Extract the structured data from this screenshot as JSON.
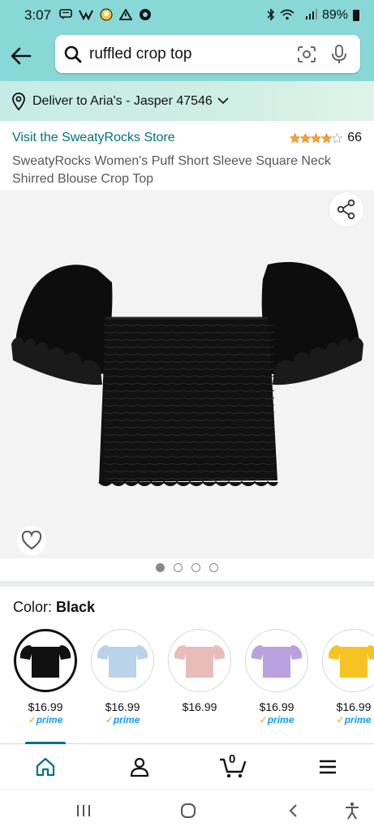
{
  "status_bar": {
    "time": "3:07",
    "battery": "89%"
  },
  "search": {
    "query": "ruffled crop top"
  },
  "delivery": {
    "text": "Deliver to Aria's - Jasper 47546"
  },
  "product": {
    "store_link": "Visit the SweatyRocks Store",
    "rating_stars": 4,
    "rating_count": "66",
    "title": "SweatyRocks Women's Puff Short Sleeve Square Neck Shirred Blouse Crop Top"
  },
  "gallery": {
    "image_count": 4,
    "active_index": 0
  },
  "color": {
    "label": "Color:",
    "selected": "Black",
    "swatches": [
      {
        "color": "#111111",
        "price": "$16.99",
        "prime": "prime",
        "selected": true
      },
      {
        "color": "#b9d3ea",
        "price": "$16.99",
        "prime": "prime",
        "selected": false
      },
      {
        "color": "#e8bcb8",
        "price": "$16.99",
        "prime": "",
        "selected": false
      },
      {
        "color": "#b9a0df",
        "price": "$16.99",
        "prime": "prime",
        "selected": false
      },
      {
        "color": "#f5c423",
        "price": "$16.99",
        "prime": "prime",
        "selected": false
      }
    ]
  },
  "cart": {
    "count": "0"
  },
  "colors": {
    "header_bg": "#88d8d8",
    "link": "#007185",
    "star": "#FFA41C",
    "prime": "#1399ff"
  }
}
